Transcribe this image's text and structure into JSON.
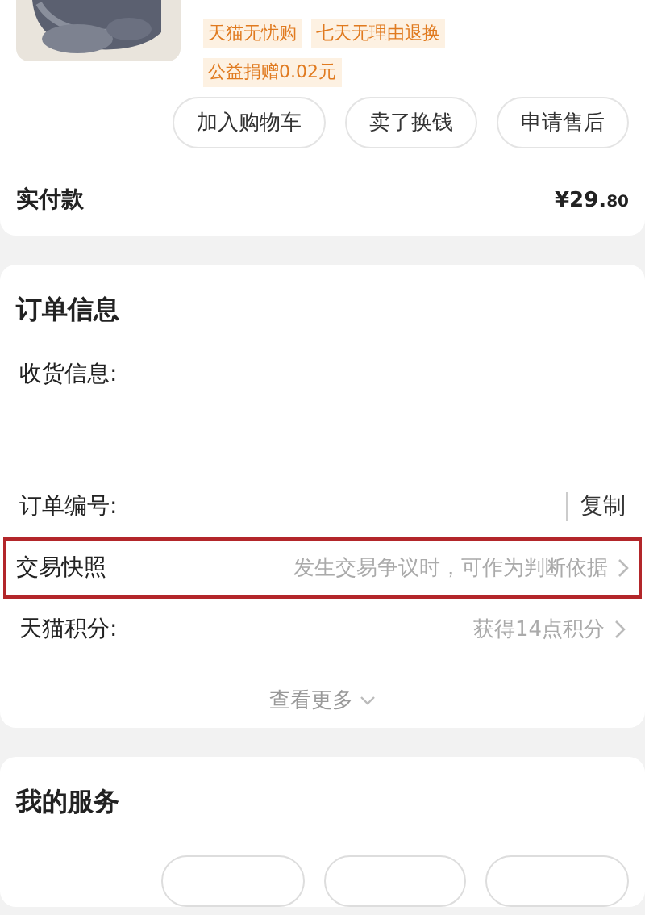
{
  "product": {
    "picture": {
      "kind": "picture"
    },
    "tags": [
      {
        "label": "天猫无忧购"
      },
      {
        "label": "七天无理由退换"
      },
      {
        "label": "公益捐赠0.02元"
      }
    ],
    "actions": [
      "加入购物车",
      "卖了换钱",
      "申请售后"
    ]
  },
  "payment": {
    "label": "实付款",
    "currency": "¥",
    "amount": "29.",
    "cents": "80"
  },
  "order_info": {
    "title": "订单信息",
    "rows": [
      {
        "kind": "address",
        "label": "收货信息:"
      },
      {
        "kind": "copy",
        "label": "订单编号:",
        "action": "复制"
      },
      {
        "kind": "link",
        "label": "交易快照",
        "hint": "发生交易争议时，可作为判断依据",
        "highlighted": true
      },
      {
        "kind": "link",
        "label": "天猫积分:",
        "hint": "获得14点积分",
        "highlighted": false
      }
    ],
    "more": "查看更多"
  },
  "services": {
    "title": "我的服务"
  }
}
